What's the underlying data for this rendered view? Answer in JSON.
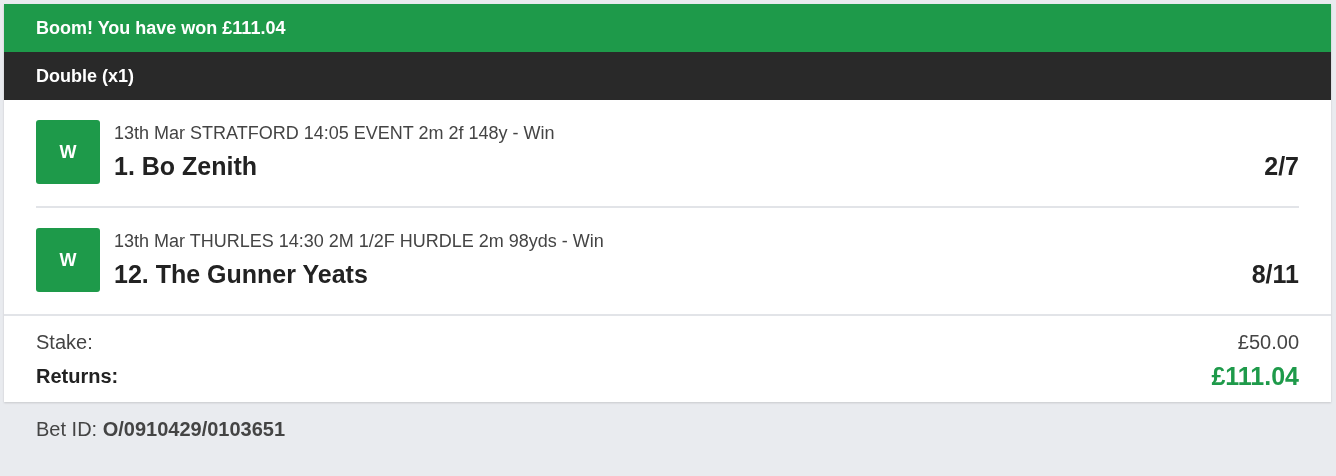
{
  "banner": {
    "text": "Boom! You have won £111.04"
  },
  "bet_type": "Double (x1)",
  "selections": [
    {
      "result": "W",
      "event": "13th Mar STRATFORD 14:05 EVENT 2m 2f 148y - Win",
      "runner": "1. Bo Zenith",
      "odds": "2/7"
    },
    {
      "result": "W",
      "event": "13th Mar THURLES 14:30 2M 1/2F HURDLE 2m 98yds - Win",
      "runner": "12. The Gunner Yeats",
      "odds": "8/11"
    }
  ],
  "totals": [
    {
      "kind": "stake",
      "label": "Stake:",
      "value": "£50.00"
    },
    {
      "kind": "returns",
      "label": "Returns:",
      "value": "£111.04"
    }
  ],
  "bet_id": "Bet ID: **O/0910429/0103651**"
}
